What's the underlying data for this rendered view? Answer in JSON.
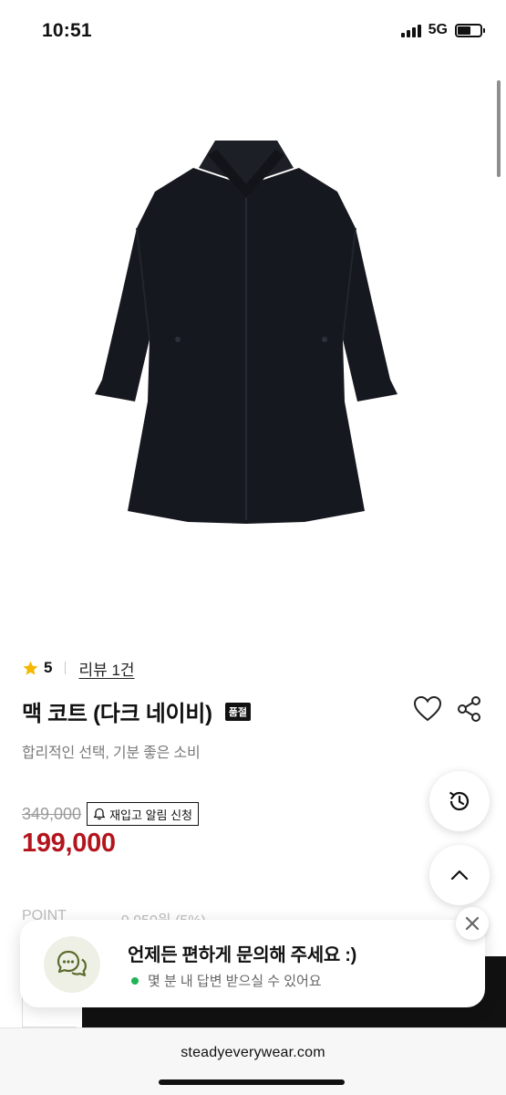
{
  "status_bar": {
    "time": "10:51",
    "network": "5G"
  },
  "product": {
    "rating": "5",
    "review_link": "리뷰 1건",
    "title": "맥 코트 (다크 네이비)",
    "soldout_badge": "품절",
    "subtitle": "합리적인 선택, 기분 좋은 소비",
    "original_price": "349,000",
    "restock_button": "재입고 알림 신청",
    "sale_price": "199,000",
    "point_label": "POINT",
    "point_value": "9,950원 (5%)"
  },
  "chat_toast": {
    "title": "언제든 편하게 문의해 주세요 :)",
    "status": "몇 분 내 답변 받으실 수 있어요"
  },
  "browser": {
    "url": "steadyeverywear.com"
  },
  "colors": {
    "sale_price": "#b3151d",
    "star": "#f5b800",
    "online": "#1fb455"
  },
  "icons": [
    "star-icon",
    "heart-icon",
    "share-icon",
    "bell-icon",
    "history-icon",
    "chevron-up-icon",
    "chat-bubbles-icon",
    "close-icon"
  ]
}
